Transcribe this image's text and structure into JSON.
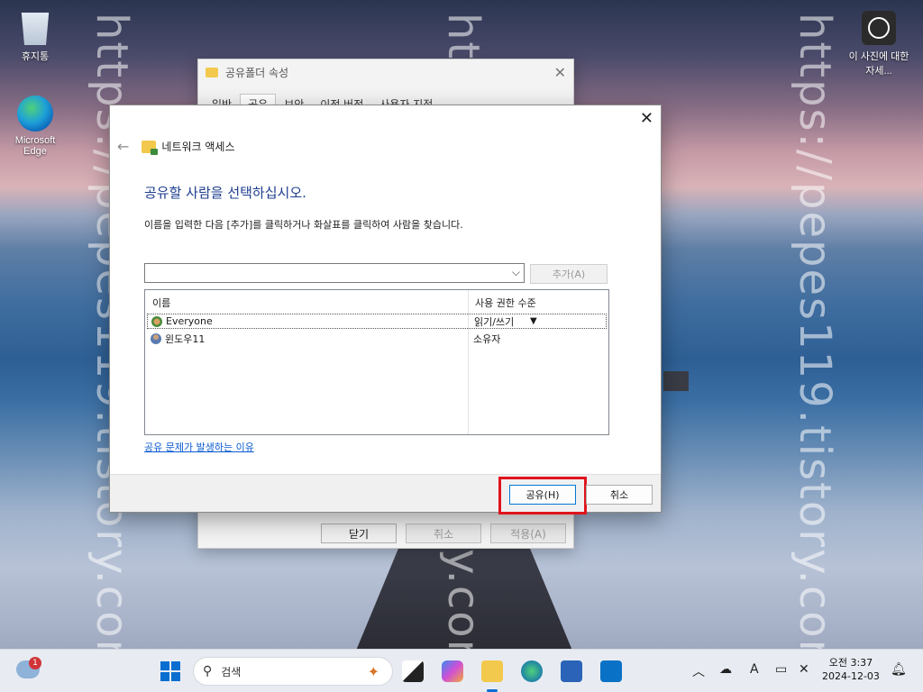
{
  "desktop": {
    "watermark": "https://pepes119.tistory.com/",
    "icons": [
      {
        "label": "휴지통",
        "icon": "recycle-bin-icon"
      },
      {
        "label": "Microsoft Edge",
        "icon": "edge-icon"
      },
      {
        "label": "이 사진에 대한 자세...",
        "icon": "photo-info-icon"
      }
    ]
  },
  "props_window": {
    "title": "공유폴더 속성",
    "tabs": [
      "일반",
      "공유",
      "보안",
      "이전 버전",
      "사용자 지정"
    ],
    "active_tab": "공유",
    "footer": {
      "close": "닫기",
      "cancel": "취소",
      "apply": "적용(A)"
    }
  },
  "dialog": {
    "nav_title": "네트워크 액세스",
    "heading": "공유할 사람을 선택하십시오.",
    "description": "이름을 입력한 다음 [추가]를 클릭하거나 화살표를 클릭하여 사람을 찾습니다.",
    "combo_value": "",
    "add_button": "추가(A)",
    "columns": {
      "name": "이름",
      "permission": "사용 권한 수준"
    },
    "rows": [
      {
        "name": "Everyone",
        "permission": "읽기/쓰기",
        "selected": true
      },
      {
        "name": "윈도우11",
        "permission": "소유자",
        "selected": false
      }
    ],
    "help_link": "공유 문제가 발생하는 이유",
    "share_button": "공유(H)",
    "cancel_button": "취소",
    "highlight_color": "#e0141c"
  },
  "taskbar": {
    "weather_badge": "1",
    "search_placeholder": "검색",
    "clock_time": "오전 3:37",
    "clock_date": "2024-12-03",
    "input_indicator": "A"
  }
}
